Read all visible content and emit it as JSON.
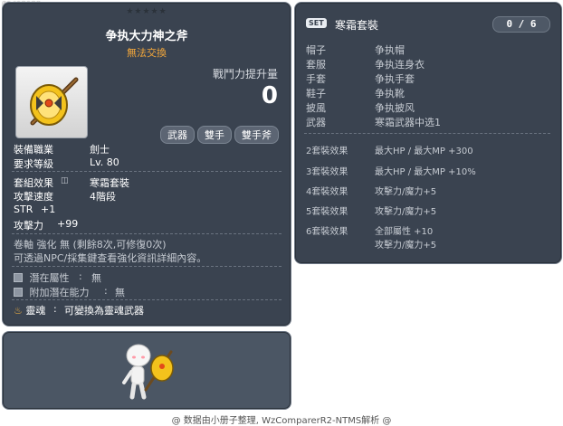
{
  "item_id": "01412129",
  "item": {
    "stars": "★★★★★",
    "name": "争执大力神之斧",
    "trade": "無法交換",
    "power_label": "戰鬥力提升量",
    "power_value": "0",
    "tags": [
      "武器",
      "雙手",
      "雙手斧"
    ],
    "job_label": "裝備職業",
    "job_value": "劍士",
    "level_label": "要求等級",
    "level_value": "Lv. 80",
    "set_effect_label": "套組效果",
    "set_effect_value": "寒霜套裝",
    "speed_label": "攻擊速度",
    "speed_value": "4階段",
    "str_label": "STR",
    "str_value": "+1",
    "atk_label": "攻擊力",
    "atk_value": "+99",
    "upgrade_line": "卷軸 強化 無 (剩餘8次,可修復0次)",
    "npc_line": "可透過NPC/採集鍵查看強化資訊詳細內容。",
    "potential_label": "潛在屬性",
    "potential_value": "無",
    "add_potential_label": "附加潛在能力",
    "add_potential_value": "無",
    "soul_label": "靈魂",
    "soul_value": "可變換為靈魂武器"
  },
  "set_panel": {
    "badge": "SET",
    "title": "寒霜套裝",
    "count": "0 / 6",
    "parts": [
      {
        "slot": "帽子",
        "name": "争执帽"
      },
      {
        "slot": "套服",
        "name": "争执连身衣"
      },
      {
        "slot": "手套",
        "name": "争执手套"
      },
      {
        "slot": "鞋子",
        "name": "争执靴"
      },
      {
        "slot": "披風",
        "name": "争执披风"
      },
      {
        "slot": "武器",
        "name": "寒霜武器中选1"
      }
    ],
    "bonuses": [
      {
        "label": "2套裝效果",
        "lines": [
          "最大HP / 最大MP  +300"
        ]
      },
      {
        "label": "3套裝效果",
        "lines": [
          "最大HP / 最大MP  +10%"
        ]
      },
      {
        "label": "4套裝效果",
        "lines": [
          "攻擊力/魔力+5"
        ]
      },
      {
        "label": "5套裝效果",
        "lines": [
          "攻擊力/魔力+5"
        ]
      },
      {
        "label": "6套裝效果",
        "lines": [
          "全部屬性 +10",
          "攻擊力/魔力+5"
        ]
      }
    ]
  },
  "footer": "@ 数据由小册子整理, WzComparerR2-NTMS解析 @"
}
